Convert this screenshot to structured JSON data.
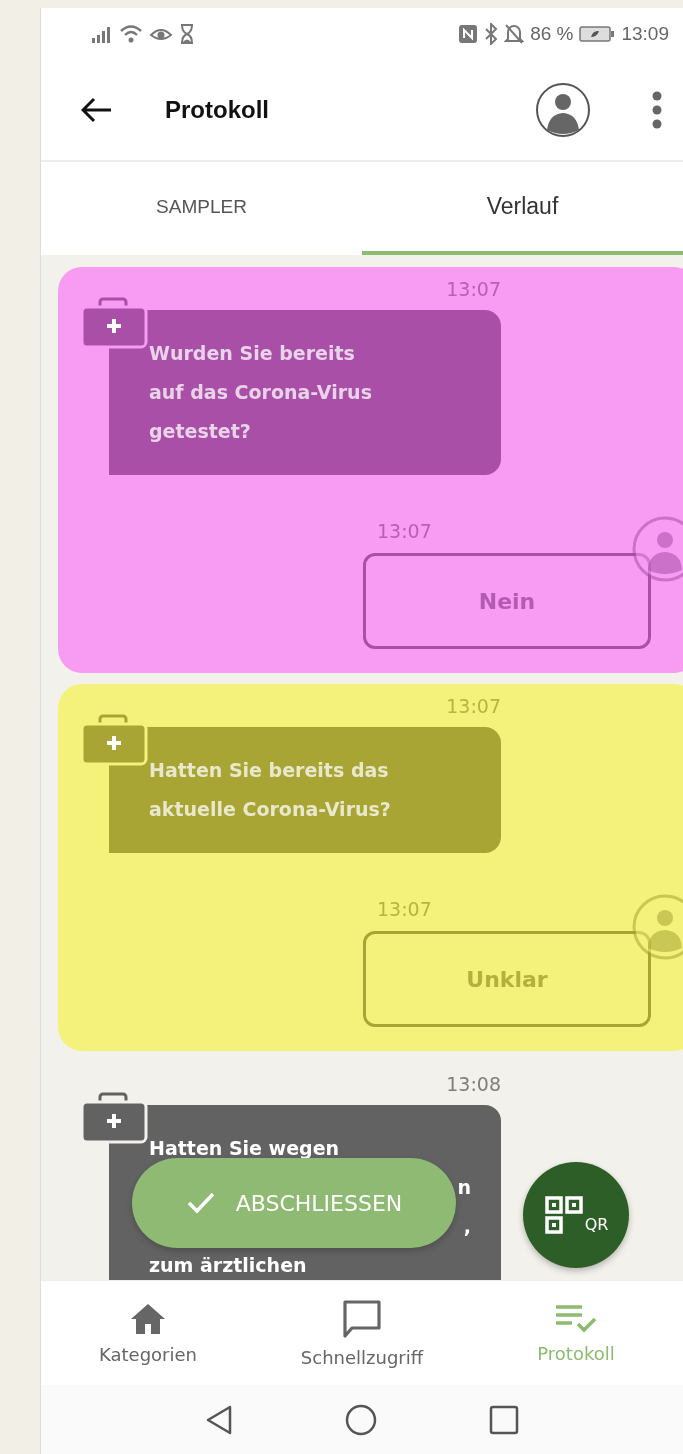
{
  "status_bar": {
    "battery": "86 %",
    "time": "13:09"
  },
  "app_bar": {
    "title": "Protokoll"
  },
  "tabs": [
    {
      "label": "SAMPLER",
      "selected": false
    },
    {
      "label": "Verlauf",
      "selected": true
    }
  ],
  "conversations": [
    {
      "color": "#f79cf2",
      "question": {
        "time": "13:07",
        "color": "#a94fa8",
        "lines": [
          {
            "text": "Wurden Sie bereits",
            "kind": "full"
          },
          {
            "text": "auf das Corona-Virus",
            "kind": "full"
          },
          {
            "text": "getestet?",
            "kind": "full"
          }
        ]
      },
      "answer": {
        "time": "13:07",
        "text": "Nein"
      }
    },
    {
      "color": "#f4f27a",
      "question": {
        "time": "13:07",
        "color": "#a8a534",
        "lines": [
          {
            "text": "Hatten Sie bereits das",
            "kind": "full"
          },
          {
            "text": "aktuelle Corona-Virus?",
            "kind": "full"
          }
        ]
      },
      "answer": {
        "time": "13:07",
        "text": "Unklar"
      }
    },
    {
      "question": {
        "time": "13:08",
        "color": "#626262",
        "lines": [
          {
            "text": "Hatten Sie wegen",
            "kind": "full"
          },
          {
            "text": "n",
            "kind": "partial"
          },
          {
            "text": ",",
            "kind": "partial"
          },
          {
            "text": "zum ärztlichen",
            "kind": "full"
          }
        ]
      }
    }
  ],
  "finish_button": {
    "label": "ABSCHLIESSEN"
  },
  "qr_button": {
    "label": "QR"
  },
  "bottom_nav": [
    {
      "label": "Kategorien",
      "kind": "home",
      "selected": false
    },
    {
      "label": "Schnellzugriff",
      "kind": "chat",
      "selected": false
    },
    {
      "label": "Protokoll",
      "kind": "checklist",
      "selected": true
    }
  ]
}
